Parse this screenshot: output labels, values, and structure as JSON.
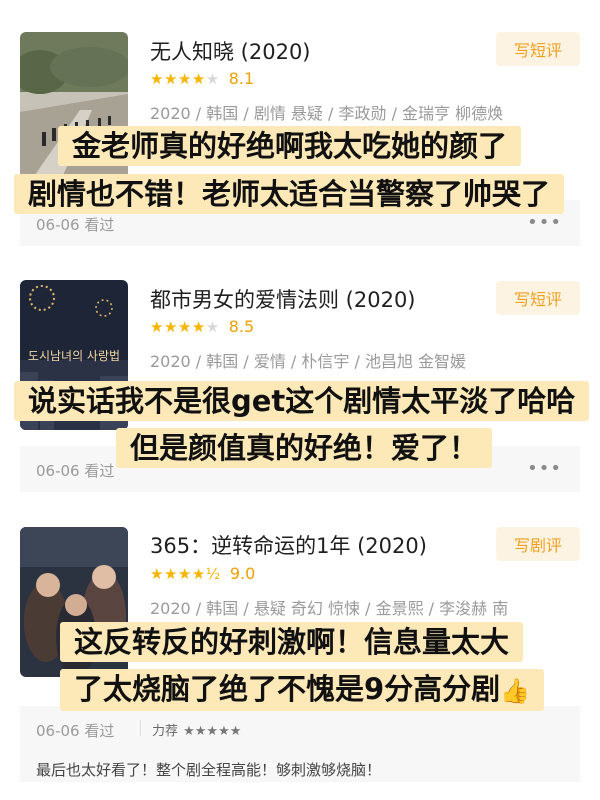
{
  "items": [
    {
      "title": "无人知晓 (2020)",
      "stars": "★★★★",
      "stars_off": "★",
      "score": "8.1",
      "meta": "2020 / 韩国 / 剧情 悬疑 / 李政勋 / 金瑞亨 柳德焕",
      "action": "写短评",
      "date": "06-06 看过",
      "more": "•••",
      "captions": [
        "金老师真的好绝啊我太吃她的颜了",
        "剧情也不错！老师太适合当警察了帅哭了"
      ]
    },
    {
      "title": "都市男女的爱情法则 (2020)",
      "stars": "★★★★",
      "stars_off": "★",
      "score": "8.5",
      "meta": "2020 / 韩国 / 爱情 / 朴信宇 / 池昌旭 金智媛",
      "poster_text": "도시남녀의 사랑법",
      "action": "写短评",
      "date": "06-06 看过",
      "more": "•••",
      "captions": [
        "说实话我不是很get这个剧情太平淡了哈哈",
        "但是颜值真的好绝！爱了！"
      ]
    },
    {
      "title": "365：逆转命运的1年 (2020)",
      "stars": "★★★★½",
      "score": "9.0",
      "meta": "2020 / 韩国 / 悬疑 奇幻 惊悚 / 金景熙 / 李浚赫 南",
      "action": "写剧评",
      "date": "06-06 看过",
      "recommend_label": "力荐",
      "recommend_stars": "★★★★★",
      "comment": "最后也太好看了！整个剧全程高能！够刺激够烧脑！",
      "captions": [
        "这反转反的好刺激啊！信息量太大",
        "了太烧脑了绝了不愧是9分高分剧"
      ],
      "caption_emoji": "👍"
    }
  ]
}
